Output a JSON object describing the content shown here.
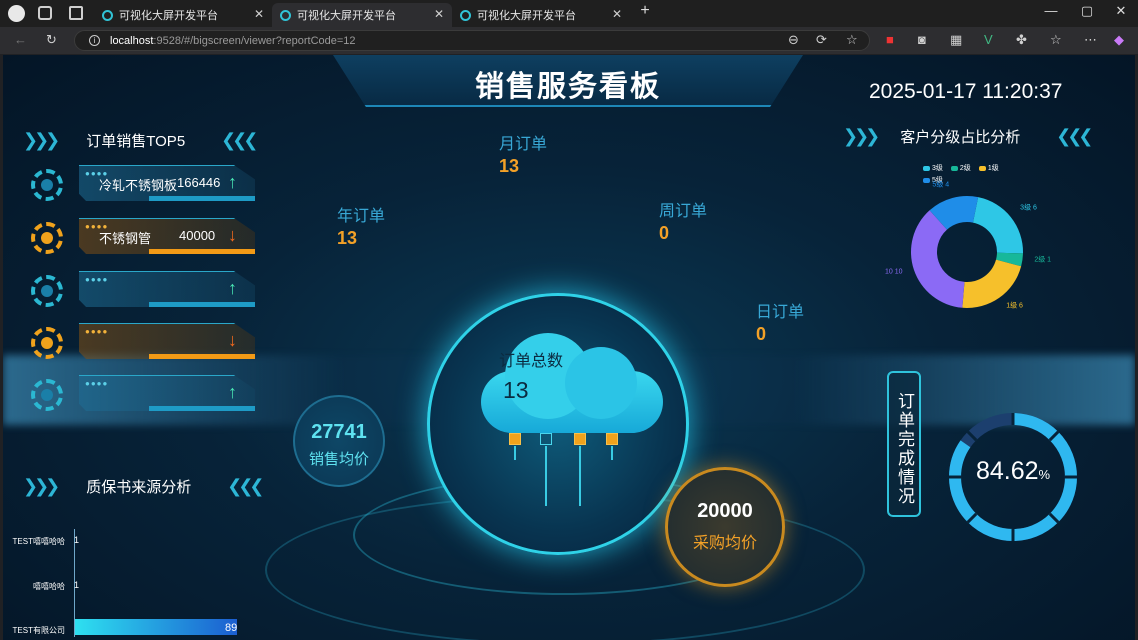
{
  "browser": {
    "tabs": [
      {
        "title": "可视化大屏开发平台"
      },
      {
        "title": "可视化大屏开发平台"
      },
      {
        "title": "可视化大屏开发平台"
      }
    ],
    "url_host": "localhost",
    "url_path": ":9528/#/bigscreen/viewer?reportCode=12"
  },
  "dashboard": {
    "title": "销售服务看板",
    "datetime": "2025-01-17 11:20:37",
    "top5": {
      "heading": "订单销售TOP5",
      "items": [
        {
          "name": "冷轧不锈钢板",
          "value": "166446",
          "trend": "up",
          "tag": "data presentation"
        },
        {
          "name": "不锈钢管",
          "value": "40000",
          "trend": "down",
          "tag": "data presentation"
        },
        {
          "name": "",
          "value": "",
          "trend": "up",
          "tag": "data presentation"
        },
        {
          "name": "",
          "value": "",
          "trend": "down",
          "tag": "data presentation"
        },
        {
          "name": "",
          "value": "",
          "trend": "up",
          "tag": "data presentation"
        }
      ]
    },
    "orders": {
      "month": {
        "label": "月订单",
        "value": "13"
      },
      "year": {
        "label": "年订单",
        "value": "13"
      },
      "week": {
        "label": "周订单",
        "value": "0"
      },
      "day": {
        "label": "日订单",
        "value": "0"
      },
      "total": {
        "label": "订单总数",
        "value": "13"
      }
    },
    "avg_sales": {
      "value": "27741",
      "label": "销售均价"
    },
    "avg_purchase": {
      "value": "20000",
      "label": "采购均价"
    },
    "customer_level": {
      "heading": "客户分级占比分析",
      "legend": [
        {
          "name": "3级",
          "color": "#2ec7e6"
        },
        {
          "name": "2级",
          "color": "#17b89a"
        },
        {
          "name": "1级",
          "color": "#f6c02b"
        },
        {
          "name": "5级",
          "color": "#1f8de8"
        }
      ],
      "slices": [
        {
          "name": "3级",
          "value": 6,
          "color": "#2ec7e6"
        },
        {
          "name": "2级",
          "value": 1,
          "color": "#17b89a"
        },
        {
          "name": "1级",
          "value": 6,
          "color": "#f6c02b"
        },
        {
          "name": "10",
          "value": 10,
          "color": "#8b6af5"
        },
        {
          "name": "5级",
          "value": 4,
          "color": "#1f8de8"
        }
      ]
    },
    "completion": {
      "label": "订单完成情况",
      "value": "84.62",
      "unit": "%",
      "fraction": 0.8462
    },
    "warranty": {
      "heading": "质保书来源分析",
      "rows": [
        {
          "name": "TEST嘻嘻哈哈",
          "value": "1"
        },
        {
          "name": "嘻嘻哈哈",
          "value": "1"
        },
        {
          "name": "TEST有限公司",
          "value": "89"
        }
      ]
    }
  }
}
